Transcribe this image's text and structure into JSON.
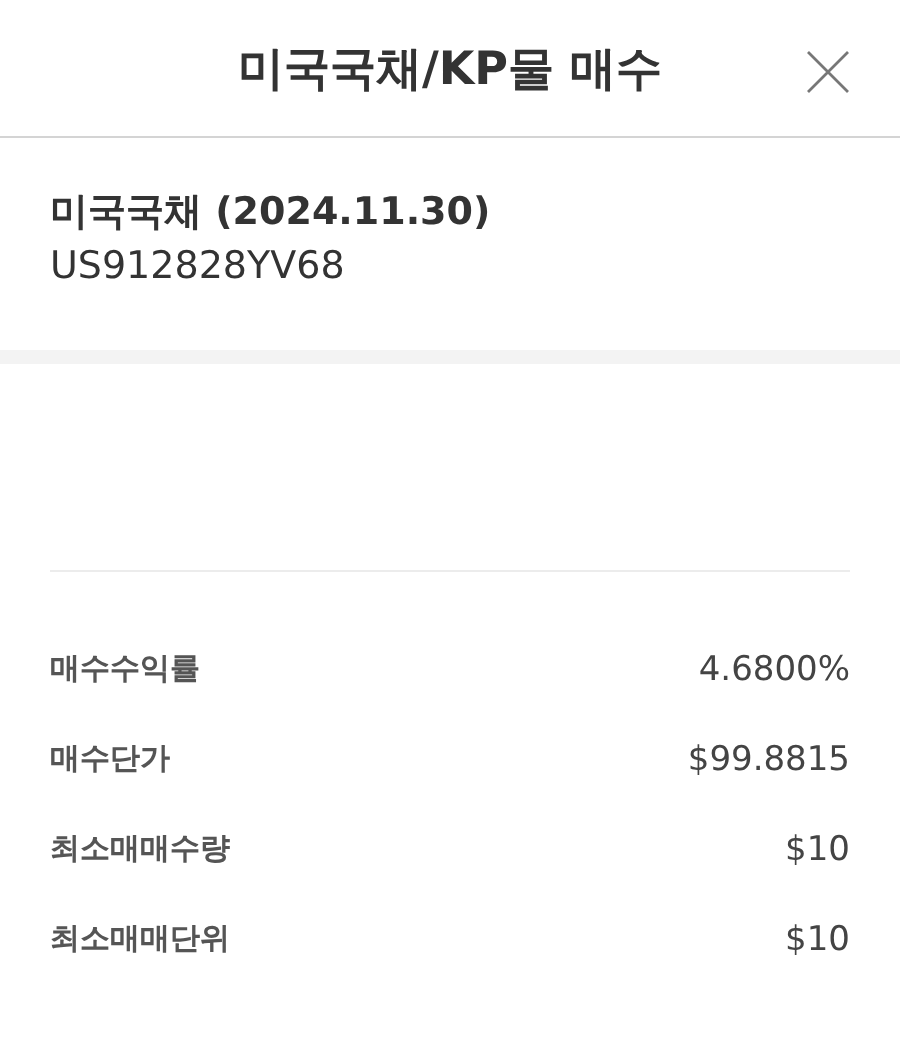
{
  "header": {
    "title": "미국국채/KP물 매수"
  },
  "bond": {
    "name": "미국국채 (2024.11.30)",
    "code": "US912828YV68"
  },
  "details": [
    {
      "label": "매수수익률",
      "value": "4.6800%"
    },
    {
      "label": "매수단가",
      "value": "$99.8815"
    },
    {
      "label": "최소매매수량",
      "value": "$10"
    },
    {
      "label": "최소매매단위",
      "value": "$10"
    }
  ]
}
